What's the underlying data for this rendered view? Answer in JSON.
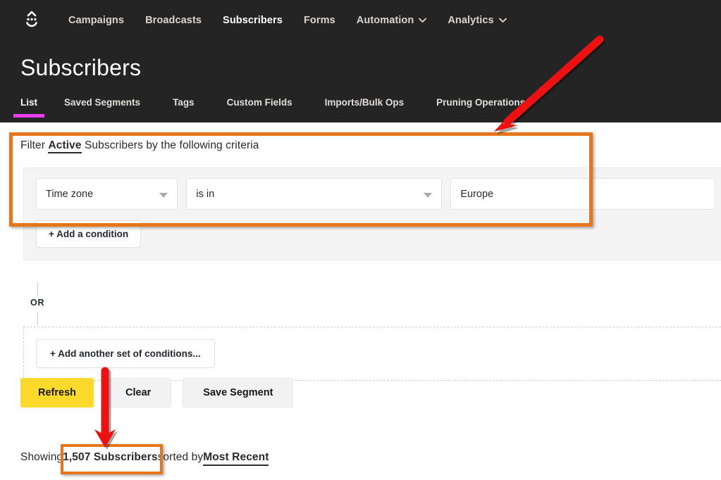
{
  "brand": {
    "logo_icon": "convertkit-smiley-logo",
    "accent_yellow": "#fcd92b",
    "accent_magenta": "#e83ef0",
    "header_bg": "#242424",
    "annotation_orange": "#e8751a",
    "annotation_red": "#ee1111"
  },
  "header": {
    "nav": [
      {
        "label": "Campaigns",
        "has_caret": false,
        "active": false
      },
      {
        "label": "Broadcasts",
        "has_caret": false,
        "active": false
      },
      {
        "label": "Subscribers",
        "has_caret": false,
        "active": true
      },
      {
        "label": "Forms",
        "has_caret": false,
        "active": false
      },
      {
        "label": "Automation",
        "has_caret": true,
        "active": false
      },
      {
        "label": "Analytics",
        "has_caret": true,
        "active": false
      }
    ],
    "title": "Subscribers",
    "tabs": [
      {
        "label": "List",
        "active": true
      },
      {
        "label": "Saved Segments",
        "active": false
      },
      {
        "label": "Tags",
        "active": false
      },
      {
        "label": "Custom Fields",
        "active": false
      },
      {
        "label": "Imports/Bulk Ops",
        "active": false
      },
      {
        "label": "Pruning Operations",
        "active": false
      }
    ]
  },
  "filter": {
    "heading_prefix": "Filter ",
    "heading_status": "Active",
    "heading_suffix": " Subscribers by the following criteria",
    "condition": {
      "field": "Time zone",
      "operator": "is in",
      "value": "Europe"
    },
    "add_condition_label": "+ Add a condition",
    "or_label": "OR",
    "add_set_label": "+ Add another set of conditions..."
  },
  "actions": {
    "refresh_label": "Refresh",
    "clear_label": "Clear",
    "save_segment_label": "Save Segment"
  },
  "status": {
    "showing_prefix": "Showing ",
    "count_text": "1,507 Subscribers",
    "sorted_by_text": " sorted by ",
    "sort_value": "Most Recent"
  },
  "annotations": {
    "highlight_filter_panel": "orange-rectangle-around-filter-criteria",
    "highlight_subscriber_count": "orange-rectangle-around-count",
    "arrow_to_filter": "red-diagonal-arrow-pointing-to-filter-panel",
    "arrow_to_count": "red-down-arrow-pointing-to-subscriber-count"
  }
}
